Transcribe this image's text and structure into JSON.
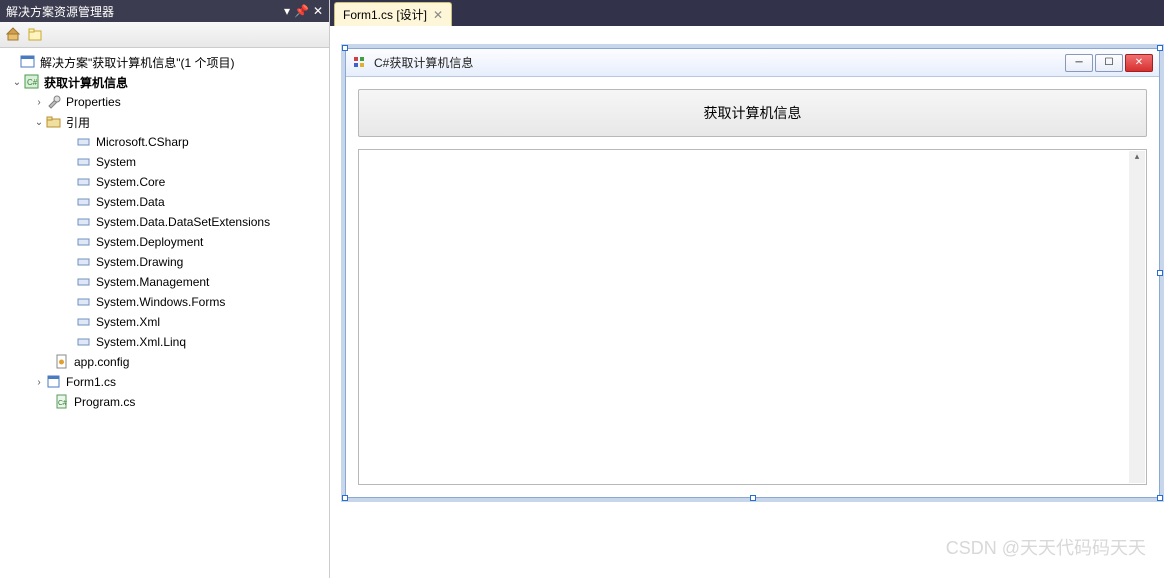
{
  "panel": {
    "title": "解决方案资源管理器",
    "pin_tooltip": "自动隐藏",
    "close_tooltip": "关闭"
  },
  "solution_label": "解决方案\"获取计算机信息\"(1 个项目)",
  "project_label": "获取计算机信息",
  "nodes": {
    "properties": "Properties",
    "references": "引用",
    "refs": [
      "Microsoft.CSharp",
      "System",
      "System.Core",
      "System.Data",
      "System.Data.DataSetExtensions",
      "System.Deployment",
      "System.Drawing",
      "System.Management",
      "System.Windows.Forms",
      "System.Xml",
      "System.Xml.Linq"
    ],
    "appconfig": "app.config",
    "form1": "Form1.cs",
    "program": "Program.cs"
  },
  "tab": {
    "label": "Form1.cs [设计]"
  },
  "form": {
    "title": "C#获取计算机信息",
    "button_text": "获取计算机信息"
  },
  "watermark": "CSDN @天天代码码天天"
}
